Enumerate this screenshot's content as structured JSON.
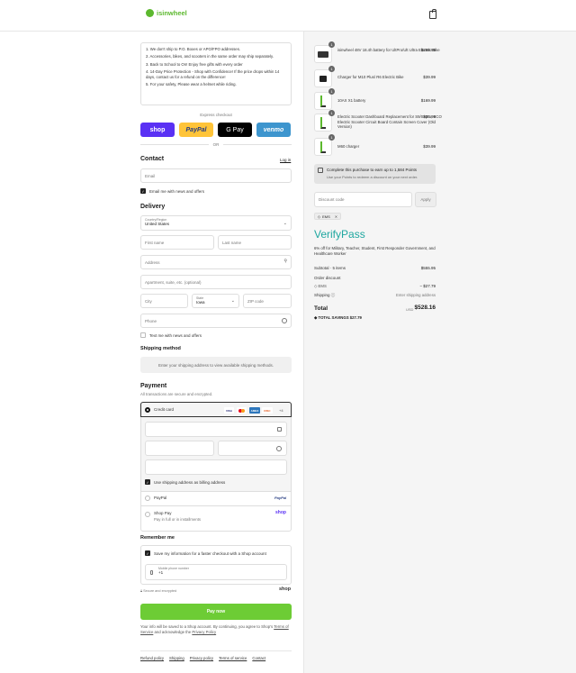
{
  "header": {
    "brand": "isinwheel"
  },
  "notice": {
    "items": [
      "1.  We don't ship to P.O. Boxes or APO/FPO addresses.",
      "2.  Accessories, bikes, and scooters in the same order may ship separately.",
      "3.  Back to School to On! Enjoy free gifts with every order",
      "4.  14-Day Price Protection - Shop with Confidence! If the price drops within 14 days, contact us for a refund on the difference!",
      "5.  For your safety, Please wear a helmet while riding."
    ]
  },
  "express": {
    "label": "Express checkout",
    "shop": "shop",
    "paypal": "PayPal",
    "gpay": "G Pay",
    "venmo": "venmo",
    "or": "OR"
  },
  "contact": {
    "title": "Contact",
    "login": "Log in",
    "email_placeholder": "Email",
    "email_news": "Email me with news and offers"
  },
  "delivery": {
    "title": "Delivery",
    "country_label": "Country/Region",
    "country": "United States",
    "first_name": "First name",
    "last_name": "Last name",
    "address": "Address",
    "apartment": "Apartment, suite, etc. (optional)",
    "city": "City",
    "state_label": "State",
    "state": "Iowa",
    "zip": "ZIP code",
    "phone": "Phone",
    "text_news": "Text me with news and offers"
  },
  "shipping": {
    "title": "Shipping method",
    "placeholder": "Enter your shipping address to view available shipping methods."
  },
  "payment": {
    "title": "Payment",
    "subtitle": "All transactions are secure and encrypted.",
    "credit_card": "Credit card",
    "cards": [
      "VISA",
      "MC",
      "AMEX",
      "DISC"
    ],
    "more_cards": "+4",
    "billing_same": "Use shipping address as billing address",
    "paypal": "PayPal",
    "paypal_logo": "PayPal",
    "shop_pay": "Shop Pay",
    "shop_pay_sub": "Pay in full or in installments",
    "shop_logo": "shop"
  },
  "remember": {
    "title": "Remember me",
    "save_info": "Save my information for a faster checkout with a Shop account",
    "phone_label": "Mobile phone number",
    "phone_value": "+1",
    "secure": "Secure and encrypted",
    "shop_logo": "shop"
  },
  "pay_now": "Pay now",
  "legal": {
    "text": "Your info will be saved to a Shop account. By continuing, you agree to Shop's",
    "terms": "Terms of Service",
    "and": "and acknowledge the",
    "privacy": "Privacy Policy"
  },
  "footer_links": [
    "Refund policy",
    "Shipping",
    "Privacy policy",
    "Terms of service",
    "Contact"
  ],
  "cart": {
    "items": [
      {
        "qty": "1",
        "name": "isinwheel 48V 18.4h battery for UltPro/Ult Ultra Electric Bike",
        "price": "$269.99"
      },
      {
        "qty": "1",
        "name": "Charger for M10 Plus/ R6 Electric Bike",
        "price": "$39.99"
      },
      {
        "qty": "1",
        "name": "10AX X1 battery",
        "price": "$169.99"
      },
      {
        "qty": "1",
        "name": "Electric Scooter Dashboard Replacement for S9/S9pro, ECO Electric Scooter Circuit Board Contain Screen Cover (Old Version)",
        "price": "$35.99"
      },
      {
        "qty": "1",
        "name": "M60 charger",
        "price": "$39.99"
      }
    ],
    "points_title": "Complete this purchase to earn up to 1,584 Points",
    "points_sub": "Use your Points to redeem a discount on your next order.",
    "discount_placeholder": "Discount code",
    "apply": "Apply",
    "applied_code": "EMS",
    "verify_logo": "VerifyPass",
    "verify_text": "6% off for Military, Teacher, Student, First Responder Government, and Healthcare Worker",
    "subtotal_label": "Subtotal · 5 items",
    "subtotal": "$555.95",
    "order_discount": "Order discount",
    "discount_code": "EMS",
    "discount_value": "− $27.79",
    "shipping_label": "Shipping",
    "shipping_value": "Enter shipping address",
    "total_label": "Total",
    "currency": "USD",
    "total": "$528.16",
    "savings_label": "TOTAL SAVINGS",
    "savings": "$27.79"
  }
}
